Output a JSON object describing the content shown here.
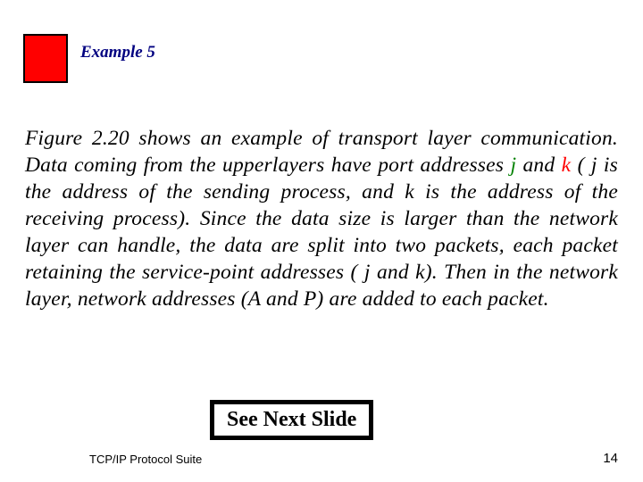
{
  "title": "Example 5",
  "body": {
    "pre": "Figure 2.20 shows an example of transport layer communication. Data coming from the upperlayers have port addresses ",
    "j": "j",
    "mid1": " and ",
    "k": "k",
    "post": " ( j is the address of the sending process, and k is the address of the receiving process). Since the data size is larger than the network layer can handle, the data are split into two packets, each packet retaining the service-point addresses ( j and k). Then in the network layer, network addresses (A and P) are added to each packet."
  },
  "nextSlide": "See Next Slide",
  "footerLeft": "TCP/IP Protocol Suite",
  "footerRight": "14"
}
